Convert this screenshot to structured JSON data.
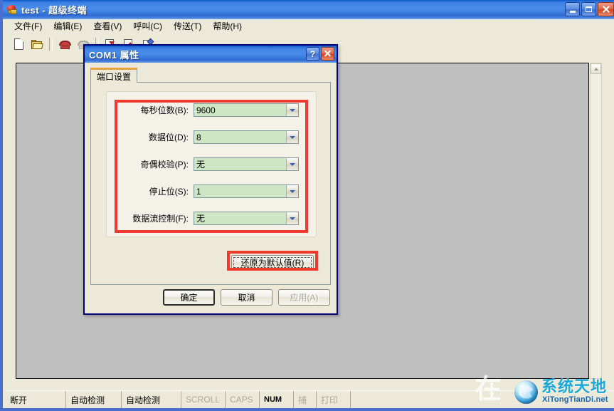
{
  "window": {
    "title": "test - 超级终端",
    "icon": "modem-phone-icon",
    "minimize_label": "最小化",
    "maximize_label": "最大化",
    "close_label": "关闭"
  },
  "menubar": {
    "items": [
      {
        "label": "文件(F)"
      },
      {
        "label": "编辑(E)"
      },
      {
        "label": "查看(V)"
      },
      {
        "label": "呼叫(C)"
      },
      {
        "label": "传送(T)"
      },
      {
        "label": "帮助(H)"
      }
    ]
  },
  "toolbar": {
    "buttons": [
      {
        "name": "new-connection-icon"
      },
      {
        "name": "open-connection-icon"
      },
      {
        "name": "call-icon"
      },
      {
        "name": "disconnect-icon"
      },
      {
        "name": "send-icon"
      },
      {
        "name": "receive-icon"
      },
      {
        "name": "properties-icon"
      }
    ]
  },
  "terminal": {
    "content": ""
  },
  "dialog": {
    "title": "COM1 属性",
    "help_label": "?",
    "close_label": "关闭",
    "tabs": [
      {
        "label": "端口设置",
        "active": true
      }
    ],
    "fields": [
      {
        "label": "每秒位数(B):",
        "value": "9600",
        "name": "bits-per-second"
      },
      {
        "label": "数据位(D):",
        "value": "8",
        "name": "data-bits"
      },
      {
        "label": "奇偶校验(P):",
        "value": "无",
        "name": "parity"
      },
      {
        "label": "停止位(S):",
        "value": "1",
        "name": "stop-bits"
      },
      {
        "label": "数据流控制(F):",
        "value": "无",
        "name": "flow-control"
      }
    ],
    "restore_defaults_label": "还原为默认值(R)",
    "ok_label": "确定",
    "cancel_label": "取消",
    "apply_label": "应用(A)",
    "apply_disabled": true
  },
  "statusbar": {
    "cells": [
      {
        "label": "断开",
        "state": "normal"
      },
      {
        "label": "自动检测",
        "state": "normal"
      },
      {
        "label": "自动检测",
        "state": "normal"
      },
      {
        "label": "SCROLL",
        "state": "dim"
      },
      {
        "label": "CAPS",
        "state": "dim"
      },
      {
        "label": "NUM",
        "state": "bold"
      },
      {
        "label": "捕",
        "state": "dim"
      },
      {
        "label": "打印",
        "state": "dim"
      }
    ]
  },
  "watermark": {
    "mark": "在",
    "brand_cn": "系统天地",
    "brand_en": "XiTongTianDi.net"
  },
  "colors": {
    "titlebar_blue": "#3f84e6",
    "dialog_border": "#00007e",
    "face": "#ece9d8",
    "combo_green": "#cfe6c4",
    "highlight_red": "#f03a2e",
    "terminal_gray": "#bfbfbf",
    "tab_accent": "#e8a33d"
  }
}
